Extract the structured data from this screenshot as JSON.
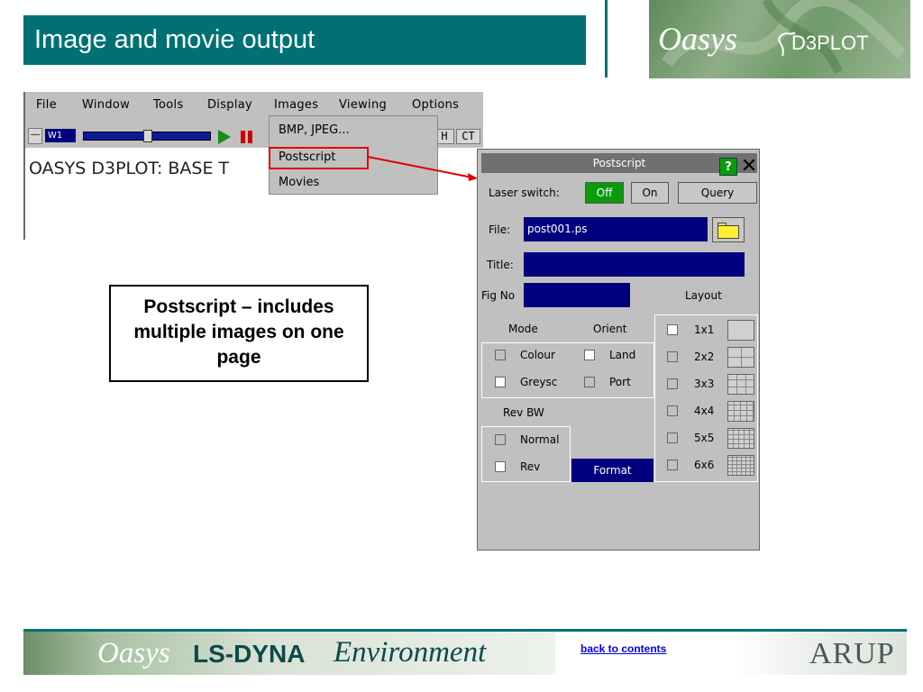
{
  "slide": {
    "title": "Image and movie output",
    "logo_brand": "Oasys",
    "logo_product": "D3PLOT",
    "callout_text": "Postscript – includes multiple images on one page"
  },
  "app": {
    "menu": [
      "File",
      "Window",
      "Tools",
      "Display",
      "Images",
      "Viewing",
      "Options"
    ],
    "toolbar": {
      "dash_label": "—",
      "window_label": "W1",
      "h_label": "H",
      "ct_label": "CT"
    },
    "window_text": "OASYS D3PLOT: BASE T",
    "images_menu": [
      "BMP, JPEG...",
      "Postscript",
      "Movies"
    ]
  },
  "postscript": {
    "title": "Postscript",
    "help_label": "?",
    "close_label": "✕",
    "laser_label": "Laser switch:",
    "laser_off": "Off",
    "laser_on": "On",
    "laser_query": "Query",
    "file_label": "File:",
    "file_value": "post001.ps",
    "title_label": "Title:",
    "title_value": "",
    "figno_label": "Fig No",
    "figno_value": "",
    "layout_label": "Layout",
    "mode_label": "Mode",
    "orient_label": "Orient",
    "mode_options": [
      "Colour",
      "Greysc"
    ],
    "orient_options": [
      "Land",
      "Port"
    ],
    "revbw_label": "Rev BW",
    "revbw_options": [
      "Normal",
      "Rev"
    ],
    "format_label": "Format",
    "layouts": [
      "1x1",
      "2x2",
      "3x3",
      "4x4",
      "5x5",
      "6x6"
    ]
  },
  "footer": {
    "brand_oasys": "Oasys",
    "brand_lsdyna": "LS-DYNA",
    "brand_env": "Environment",
    "back_link": "back to contents",
    "arup": "ARUP"
  },
  "colors": {
    "accent_teal": "#007074",
    "field_blue": "#00007e",
    "highlight_red": "#e00000",
    "toggle_green": "#0a9a0a"
  }
}
